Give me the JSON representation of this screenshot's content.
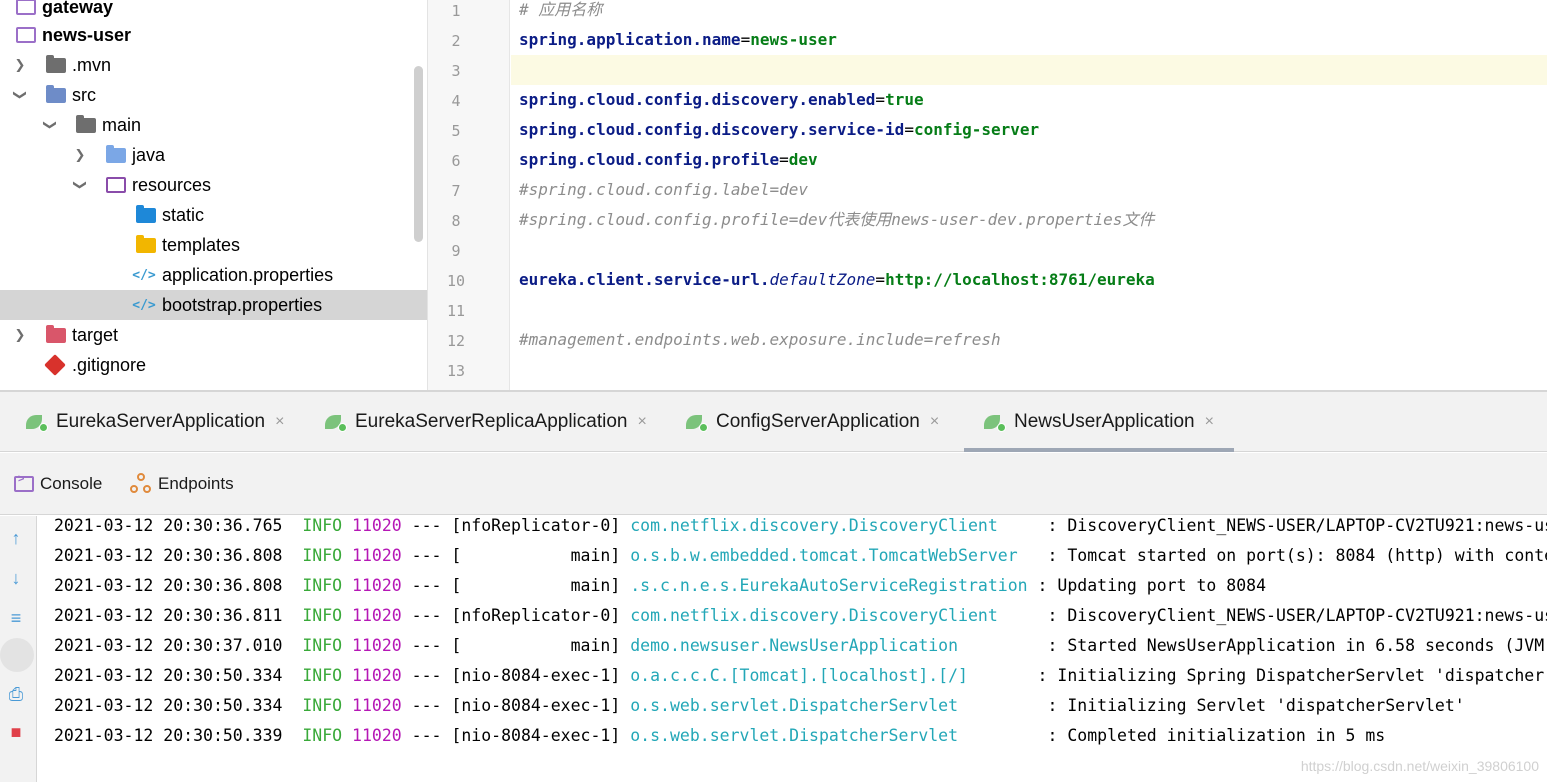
{
  "project_tree": {
    "items": [
      {
        "label": "gateway",
        "bold": true
      },
      {
        "label": "news-user",
        "bold": true
      },
      {
        "label": ".mvn"
      },
      {
        "label": "src"
      },
      {
        "label": "main"
      },
      {
        "label": "java"
      },
      {
        "label": "resources"
      },
      {
        "label": "static"
      },
      {
        "label": "templates"
      },
      {
        "label": "application.properties"
      },
      {
        "label": "bootstrap.properties",
        "selected": true
      },
      {
        "label": "target"
      },
      {
        "label": ".gitignore"
      }
    ]
  },
  "editor": {
    "line_numbers": [
      "1",
      "2",
      "3",
      "4",
      "5",
      "6",
      "7",
      "8",
      "9",
      "10",
      "11",
      "12",
      "13"
    ],
    "lines": {
      "l1": "# 应用名称",
      "l2_key": "spring.application.name",
      "l2_val": "news-user",
      "l4_key": "spring.cloud.config.discovery.enabled",
      "l4_val": "true",
      "l5_key": "spring.cloud.config.discovery.service-id",
      "l5_val": "config-server",
      "l6_key": "spring.cloud.config.profile",
      "l6_val": "dev",
      "l7": "#spring.cloud.config.label=dev",
      "l8": "#spring.cloud.config.profile=dev代表使用news-user-dev.properties文件",
      "l10_key": "eureka.client.service-url.",
      "l10_ikey": "defaultZone",
      "l10_val": "http://localhost:8761/eureka",
      "l12": "#management.endpoints.web.exposure.include=refresh"
    },
    "eq": "="
  },
  "run_tabs": [
    {
      "label": "EurekaServerApplication"
    },
    {
      "label": "EurekaServerReplicaApplication"
    },
    {
      "label": "ConfigServerApplication"
    },
    {
      "label": "NewsUserApplication",
      "active": true
    }
  ],
  "close_glyph": "×",
  "console_tabs": {
    "console": "Console",
    "endpoints": "Endpoints"
  },
  "colors": {
    "level": "#39a939",
    "pid": "#b517b5",
    "logger": "#23a7b7",
    "key": "#0b1c86",
    "value": "#067d17",
    "comment": "#8c8c8c"
  },
  "log_lines": [
    {
      "ts": "2021-03-12 20:30:36.765",
      "level": "INFO",
      "pid": "11020",
      "sep": "---",
      "thread": "[nfoReplicator-0]",
      "logger": "com.netflix.discovery.DiscoveryClient    ",
      "msg": ": DiscoveryClient_NEWS-USER/LAPTOP-CV2TU921:news-us"
    },
    {
      "ts": "2021-03-12 20:30:36.808",
      "level": "INFO",
      "pid": "11020",
      "sep": "---",
      "thread": "[           main]",
      "logger": "o.s.b.w.embedded.tomcat.TomcatWebServer  ",
      "msg": ": Tomcat started on port(s): 8084 (http) with conte"
    },
    {
      "ts": "2021-03-12 20:30:36.808",
      "level": "INFO",
      "pid": "11020",
      "sep": "---",
      "thread": "[           main]",
      "logger": ".s.c.n.e.s.EurekaAutoServiceRegistration",
      "msg": ": Updating port to 8084"
    },
    {
      "ts": "2021-03-12 20:30:36.811",
      "level": "INFO",
      "pid": "11020",
      "sep": "---",
      "thread": "[nfoReplicator-0]",
      "logger": "com.netflix.discovery.DiscoveryClient    ",
      "msg": ": DiscoveryClient_NEWS-USER/LAPTOP-CV2TU921:news-us"
    },
    {
      "ts": "2021-03-12 20:30:37.010",
      "level": "INFO",
      "pid": "11020",
      "sep": "---",
      "thread": "[           main]",
      "logger": "demo.newsuser.NewsUserApplication        ",
      "msg": ": Started NewsUserApplication in 6.58 seconds (JVM"
    },
    {
      "ts": "2021-03-12 20:30:50.334",
      "level": "INFO",
      "pid": "11020",
      "sep": "---",
      "thread": "[nio-8084-exec-1]",
      "logger": "o.a.c.c.C.[Tomcat].[localhost].[/]      ",
      "msg": ": Initializing Spring DispatcherServlet 'dispatcher"
    },
    {
      "ts": "2021-03-12 20:30:50.334",
      "level": "INFO",
      "pid": "11020",
      "sep": "---",
      "thread": "[nio-8084-exec-1]",
      "logger": "o.s.web.servlet.DispatcherServlet        ",
      "msg": ": Initializing Servlet 'dispatcherServlet'"
    },
    {
      "ts": "2021-03-12 20:30:50.339",
      "level": "INFO",
      "pid": "11020",
      "sep": "---",
      "thread": "[nio-8084-exec-1]",
      "logger": "o.s.web.servlet.DispatcherServlet        ",
      "msg": ": Completed initialization in 5 ms"
    }
  ],
  "watermark": "https://blog.csdn.net/weixin_39806100"
}
